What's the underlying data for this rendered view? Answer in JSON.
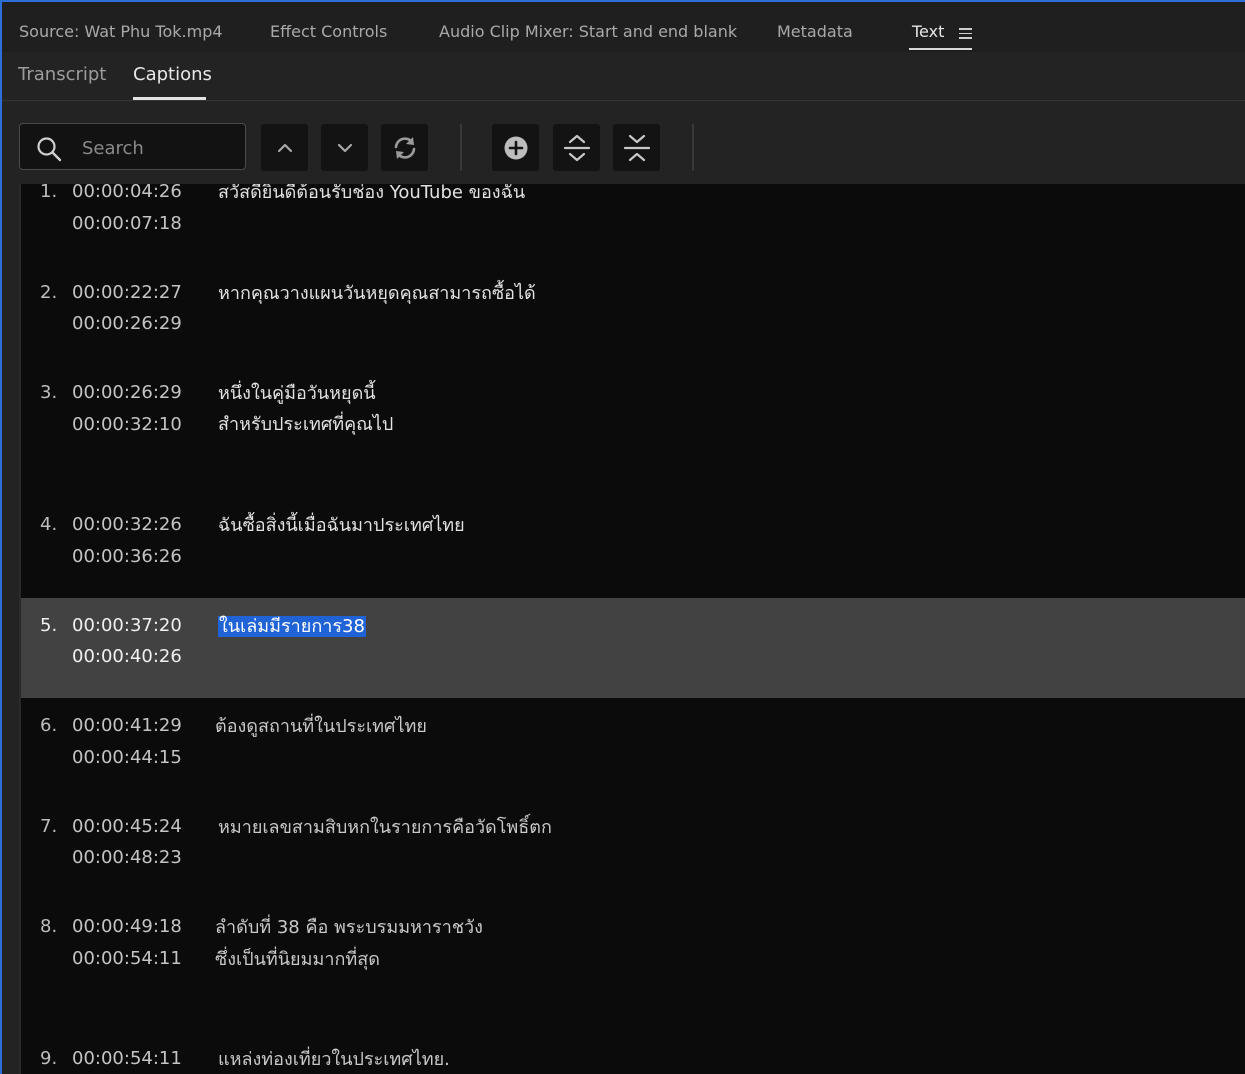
{
  "panel_tabs": [
    {
      "label": "Source: Wat Phu Tok.mp4"
    },
    {
      "label": "Effect Controls"
    },
    {
      "label": "Audio Clip Mixer: Start and end blank"
    },
    {
      "label": "Metadata"
    },
    {
      "label": "Text"
    }
  ],
  "sub_tabs": [
    {
      "label": "Transcript"
    },
    {
      "label": "Captions"
    }
  ],
  "search": {
    "placeholder": "Search",
    "value": ""
  },
  "toolbar": {
    "icons": [
      "search-icon",
      "chevron-up-icon",
      "chevron-down-icon",
      "refresh-icon",
      "add-circle-icon",
      "expand-icon",
      "collapse-icon",
      "menu-icon"
    ]
  },
  "colors": {
    "accent": "#1f63d6",
    "selected_row": "#424242",
    "list_bg": "#0b0b0b",
    "panel_border": "#2d6fd6"
  },
  "captions": [
    {
      "num": "1.",
      "start": "00:00:04:26",
      "end": "00:00:07:18",
      "lines": [
        "สวัสดียินดีต้อนรับช่อง YouTube ของฉัน"
      ]
    },
    {
      "num": "2.",
      "start": "00:00:22:27",
      "end": "00:00:26:29",
      "lines": [
        "หากคุณวางแผนวันหยุดคุณสามารถซื้อได้"
      ]
    },
    {
      "num": "3.",
      "start": "00:00:26:29",
      "end": "00:00:32:10",
      "lines": [
        "หนึ่งในคู่มือวันหยุดนี้",
        "สำหรับประเทศที่คุณไป"
      ]
    },
    {
      "num": "4.",
      "start": "00:00:32:26",
      "end": "00:00:36:26",
      "lines": [
        "ฉันซื้อสิ่งนี้เมื่อฉันมาประเทศไทย"
      ]
    },
    {
      "num": "5.",
      "start": "00:00:37:20",
      "end": "00:00:40:26",
      "lines": [
        "ในเล่มมีรายการ38"
      ]
    },
    {
      "num": "6.",
      "start": "00:00:41:29",
      "end": "00:00:44:15",
      "lines": [
        "ต้องดูสถานที่ในประเทศไทย"
      ]
    },
    {
      "num": "7.",
      "start": "00:00:45:24",
      "end": "00:00:48:23",
      "lines": [
        "หมายเลขสามสิบหกในรายการคือวัดโพธิ์ตก"
      ]
    },
    {
      "num": "8.",
      "start": "00:00:49:18",
      "end": "00:00:54:11",
      "lines": [
        "ลำดับที่ 38 คือ พระบรมมหาราชวัง",
        "ซึ่งเป็นที่นิยมมากที่สุด"
      ]
    },
    {
      "num": "9.",
      "start": "00:00:54:11",
      "end": "",
      "lines": [
        "แหล่งท่องเที่ยวในประเทศไทย."
      ]
    }
  ]
}
